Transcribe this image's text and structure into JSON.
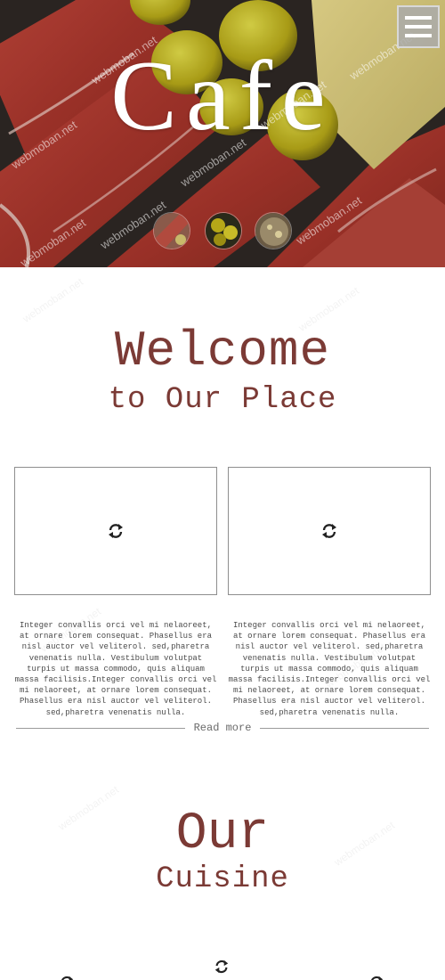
{
  "hero": {
    "title": "Cafe",
    "menu_icon": "hamburger-menu-icon",
    "watermark": "webmoban.net",
    "thumbnails": [
      {
        "name": "thumb-meat"
      },
      {
        "name": "thumb-olives"
      },
      {
        "name": "thumb-cheese"
      }
    ]
  },
  "welcome": {
    "title": "Welcome",
    "subtitle": "to Our Place",
    "cards": [
      {
        "loader_icon": "refresh-loader-icon",
        "text": "Integer convallis orci vel mi nelaoreet, at ornare lorem consequat. Phasellus era nisl auctor vel veliterol. sed,pharetra venenatis nulla. Vestibulum volutpat turpis ut massa commodo, quis aliquam massa facilisis.Integer convallis orci vel mi nelaoreet, at ornare lorem consequat. Phasellus era nisl auctor vel veliterol. sed,pharetra venenatis nulla."
      },
      {
        "loader_icon": "refresh-loader-icon",
        "text": "Integer convallis orci vel mi nelaoreet, at ornare lorem consequat. Phasellus era nisl auctor vel veliterol. sed,pharetra venenatis nulla. Vestibulum volutpat turpis ut massa commodo, quis aliquam massa facilisis.Integer convallis orci vel mi nelaoreet, at ornare lorem consequat. Phasellus era nisl auctor vel veliterol. sed,pharetra venenatis nulla."
      }
    ],
    "read_more": "Read more"
  },
  "cuisine": {
    "title": "Our",
    "subtitle": "Cuisine"
  },
  "colors": {
    "accent": "#7b3a35",
    "menu_bg": "#aaaaaa",
    "text": "#4a4a4a"
  }
}
